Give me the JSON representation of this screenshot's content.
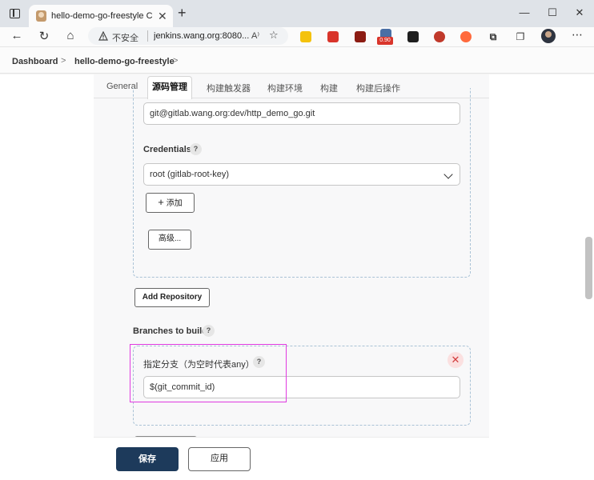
{
  "browser": {
    "tab_title": "hello-demo-go-freestyle Config",
    "tab_close": "✕",
    "new_tab": "+",
    "window_buttons": [
      "—",
      "☐",
      "✕"
    ],
    "security_label": "不安全",
    "url": "jenkins.wang.org:8080...",
    "reader_icon": "A⁾",
    "favorite_icon": "☆",
    "extension_badge": "0.90",
    "more": "⋯"
  },
  "breadcrumb": {
    "items": [
      "Dashboard",
      "hello-demo-go-freestyle"
    ],
    "separator": ">"
  },
  "config_tabs": [
    "General",
    "源码管理",
    "构建触发器",
    "构建环境",
    "构建",
    "构建后操作"
  ],
  "scm": {
    "repo_url_value": "git@gitlab.wang.org:dev/http_demo_go.git",
    "credentials_label": "Credentials",
    "credentials_value": "root (gitlab-root-key)",
    "add_button": "添加",
    "add_icon": "+",
    "advanced_button": "高级...",
    "add_repository_button": "Add Repository",
    "branches_label": "Branches to build",
    "branch_specifier_label": "指定分支（为空时代表any）",
    "branch_specifier_value": "$(git_commit_id)",
    "help": "?",
    "delete": "✕"
  },
  "footer": {
    "save_button": "保存",
    "apply_button": "应用"
  },
  "colors": {
    "primary": "#1d3a5b",
    "highlight": "#e03ae0",
    "danger": "#d23c3c"
  }
}
